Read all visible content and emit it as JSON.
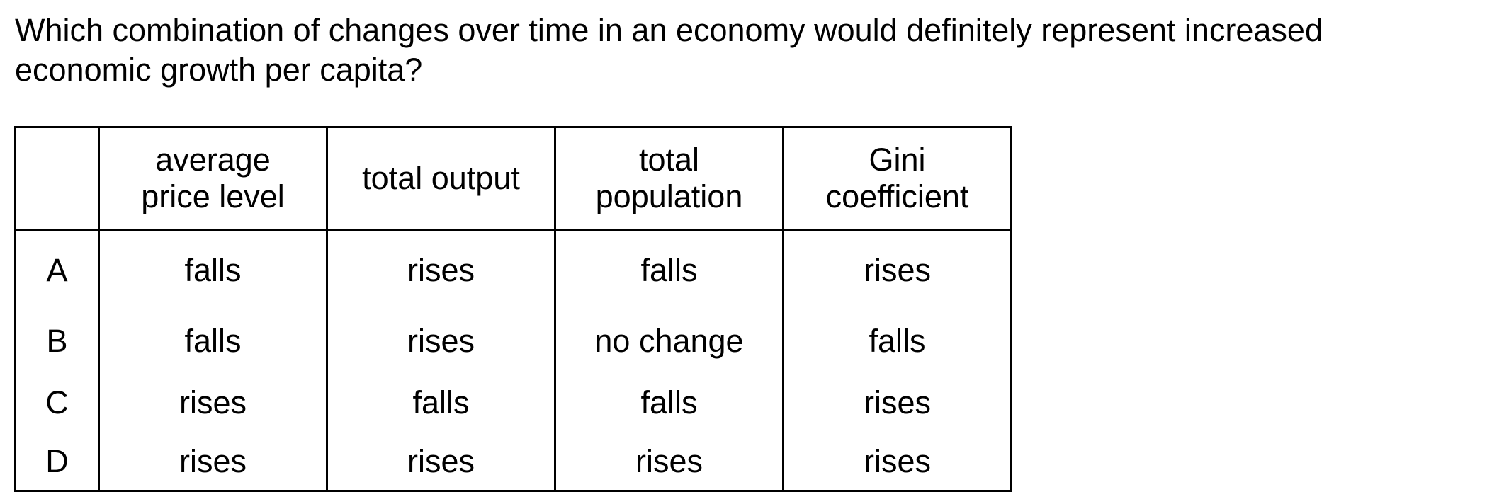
{
  "question": {
    "line1": "Which combination of changes over time in an economy would definitely represent increased",
    "line2": "economic growth per capita?"
  },
  "table": {
    "headers": [
      {
        "lines": [
          ""
        ]
      },
      {
        "lines": [
          "average",
          "price level"
        ]
      },
      {
        "lines": [
          "total output"
        ]
      },
      {
        "lines": [
          "total",
          "population"
        ]
      },
      {
        "lines": [
          "Gini",
          "coefficient"
        ]
      }
    ],
    "rows": [
      {
        "option": "A",
        "cells": [
          "falls",
          "rises",
          "falls",
          "rises"
        ]
      },
      {
        "option": "B",
        "cells": [
          "falls",
          "rises",
          "no change",
          "falls"
        ]
      },
      {
        "option": "C",
        "cells": [
          "rises",
          "falls",
          "falls",
          "rises"
        ]
      },
      {
        "option": "D",
        "cells": [
          "rises",
          "rises",
          "rises",
          "rises"
        ]
      }
    ]
  }
}
